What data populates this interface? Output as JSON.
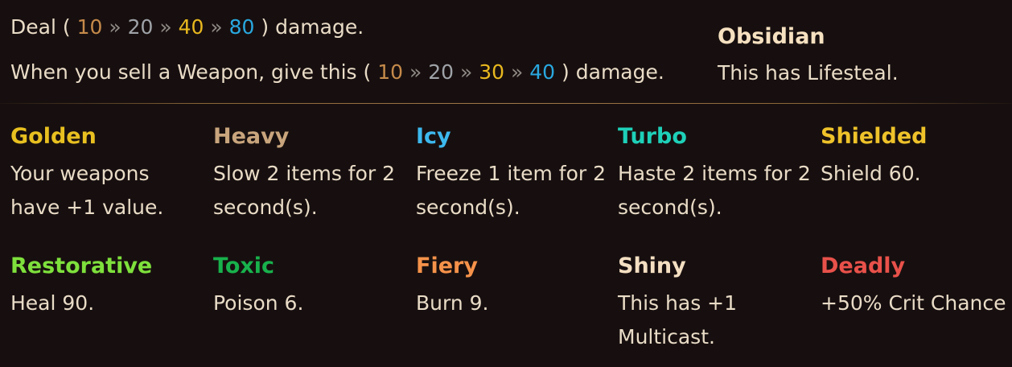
{
  "tooltip": {
    "damage_line": {
      "prefix": "Deal",
      "open": "(",
      "tier1": "10",
      "sep1": "»",
      "tier2": "20",
      "sep2": "»",
      "tier3": "40",
      "sep3": "»",
      "tier4": "80",
      "close": ")",
      "suffix": "damage."
    },
    "sell_line": {
      "prefix": "When you sell a Weapon, give this",
      "open": "(",
      "tier1": "10",
      "sep1": "»",
      "tier2": "20",
      "sep2": "»",
      "tier3": "30",
      "sep3": "»",
      "tier4": "40",
      "close": ")",
      "suffix": "damage."
    },
    "side_enchant": {
      "name": "Obsidian",
      "description": "This has Lifesteal."
    },
    "tier_colors": {
      "bronze": "#c58a4a",
      "silver": "#9fa3a8",
      "gold": "#e8b81f",
      "diamond": "#29a8df"
    },
    "enchantments": [
      {
        "name": "Golden",
        "description": "Your weapons have +1 value.",
        "color": "#e8c020"
      },
      {
        "name": "Heavy",
        "description": "Slow 2 items for 2 second(s).",
        "color": "#c9a57d"
      },
      {
        "name": "Icy",
        "description": "Freeze 1 item for 2 second(s).",
        "color": "#3db8ee"
      },
      {
        "name": "Turbo",
        "description": "Haste 2 items for 2 second(s).",
        "color": "#1ed0b8"
      },
      {
        "name": "Shielded",
        "description": "Shield 60.",
        "color": "#eec22a"
      },
      {
        "name": "Restorative",
        "description": "Heal 90.",
        "color": "#7ee03c"
      },
      {
        "name": "Toxic",
        "description": "Poison 6.",
        "color": "#18b14c"
      },
      {
        "name": "Fiery",
        "description": "Burn 9.",
        "color": "#f5924a"
      },
      {
        "name": "Shiny",
        "description": "This has +1 Multicast.",
        "color": "#f4dfc2"
      },
      {
        "name": "Deadly",
        "description": "+50% Crit Chance",
        "color": "#e8514a"
      }
    ]
  }
}
